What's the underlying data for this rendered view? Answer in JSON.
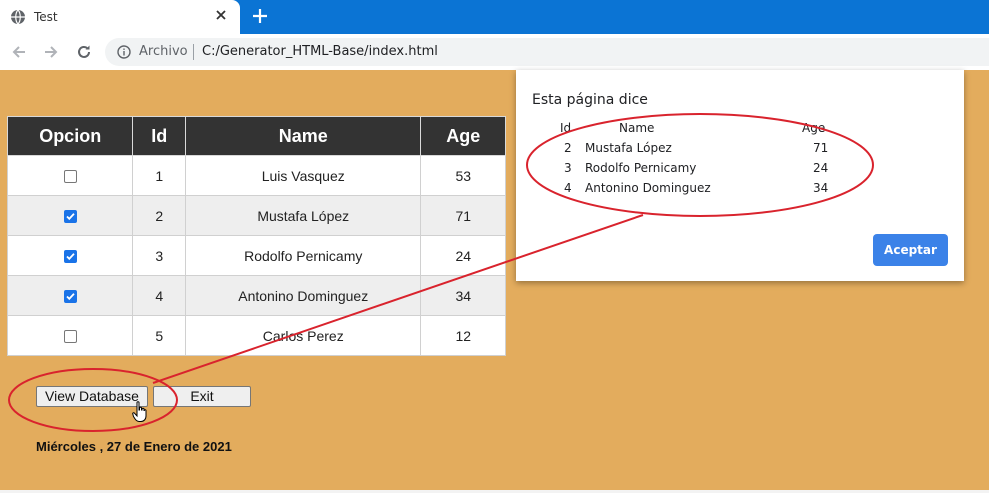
{
  "browser": {
    "tab_title": "Test",
    "omnibox_label": "Archivo",
    "url": "C:/Generator_HTML-Base/index.html"
  },
  "table": {
    "headers": [
      "Opcion",
      "Id",
      "Name",
      "Age"
    ],
    "rows": [
      {
        "checked": false,
        "id": "1",
        "name": "Luis Vasquez",
        "age": "53"
      },
      {
        "checked": true,
        "id": "2",
        "name": "Mustafa López",
        "age": "71"
      },
      {
        "checked": true,
        "id": "3",
        "name": "Rodolfo Pernicamy",
        "age": "24"
      },
      {
        "checked": true,
        "id": "4",
        "name": "Antonino Dominguez",
        "age": "34"
      },
      {
        "checked": false,
        "id": "5",
        "name": "Carlos Perez",
        "age": "12"
      }
    ]
  },
  "buttons": {
    "view_database": "View Database",
    "exit": "Exit"
  },
  "date_text": "Miércoles , 27 de Enero de 2021",
  "dialog": {
    "title": "Esta página dice",
    "headers": {
      "id": "Id",
      "name": "Name",
      "age": "Age"
    },
    "rows": [
      {
        "id": "2",
        "name": "Mustafa López",
        "age": "71"
      },
      {
        "id": "3",
        "name": "Rodolfo Pernicamy",
        "age": "24"
      },
      {
        "id": "4",
        "name": "Antonino Dominguez",
        "age": "34"
      }
    ],
    "ok_label": "Aceptar"
  },
  "colors": {
    "page_background": "#e3ac5d",
    "tabstrip": "#0b74d4",
    "table_header": "#333333",
    "checkbox_checked": "#1a73e8",
    "dialog_button": "#3b82e8",
    "annotation_red": "#d9232d"
  },
  "icons": {
    "tab": "globe-icon",
    "tab_close": "close-icon",
    "new_tab": "plus-icon",
    "back": "arrow-left-icon",
    "forward": "arrow-right-icon",
    "reload": "reload-icon",
    "site_info": "info-icon",
    "cursor": "hand-pointer-icon"
  }
}
